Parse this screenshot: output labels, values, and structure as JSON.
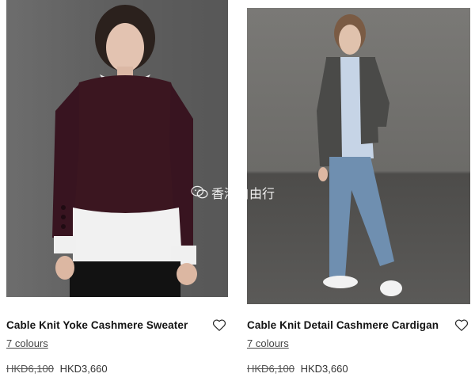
{
  "products": [
    {
      "title": "Cable Knit Yoke Cashmere Sweater",
      "colours": "7 colours",
      "price_old": "HKD6,100",
      "price_new": "HKD3,660",
      "wishlist_icon": "heart-outline-icon"
    },
    {
      "title": "Cable Knit Detail Cashmere Cardigan",
      "colours": "7 colours",
      "price_old": "HKD6,100",
      "price_new": "HKD3,660",
      "wishlist_icon": "heart-outline-icon"
    }
  ],
  "watermark": {
    "text": "香港自由行",
    "icon": "wechat-icon"
  },
  "colors": {
    "sweater": "#3b1620",
    "cardigan": "#4a4a48",
    "jeans": "#6f8fb0",
    "shirt": "#f2f2f2"
  }
}
